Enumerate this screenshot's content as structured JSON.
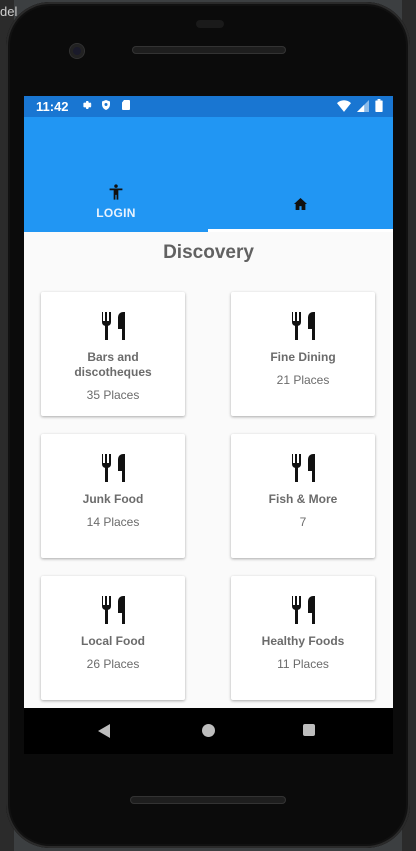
{
  "ide": {
    "tab_fragment": "del"
  },
  "status_bar": {
    "time": "11:42",
    "left_icons": [
      "gear-icon",
      "shield-icon",
      "sd-card-icon"
    ],
    "right_icons": [
      "wifi-icon",
      "signal-icon",
      "battery-icon"
    ]
  },
  "tabs": [
    {
      "label": "LOGIN",
      "icon": "person-icon",
      "selected": false
    },
    {
      "label": "",
      "icon": "home-icon",
      "selected": true
    }
  ],
  "page": {
    "title": "Discovery"
  },
  "categories": [
    {
      "name": "Bars and discotheques",
      "count": "35 Places",
      "icon": "restaurant-icon"
    },
    {
      "name": "Fine Dining",
      "count": "21 Places",
      "icon": "restaurant-icon"
    },
    {
      "name": "Junk Food",
      "count": "14 Places",
      "icon": "restaurant-icon"
    },
    {
      "name": "Fish & More",
      "count": "7",
      "icon": "restaurant-icon"
    },
    {
      "name": "Local Food",
      "count": "26 Places",
      "icon": "restaurant-icon"
    },
    {
      "name": "Healthy Foods",
      "count": "11 Places",
      "icon": "restaurant-icon"
    }
  ],
  "colors": {
    "status_bar": "#1976d2",
    "app_bar": "#2196f3",
    "indicator": "#ffffff"
  }
}
